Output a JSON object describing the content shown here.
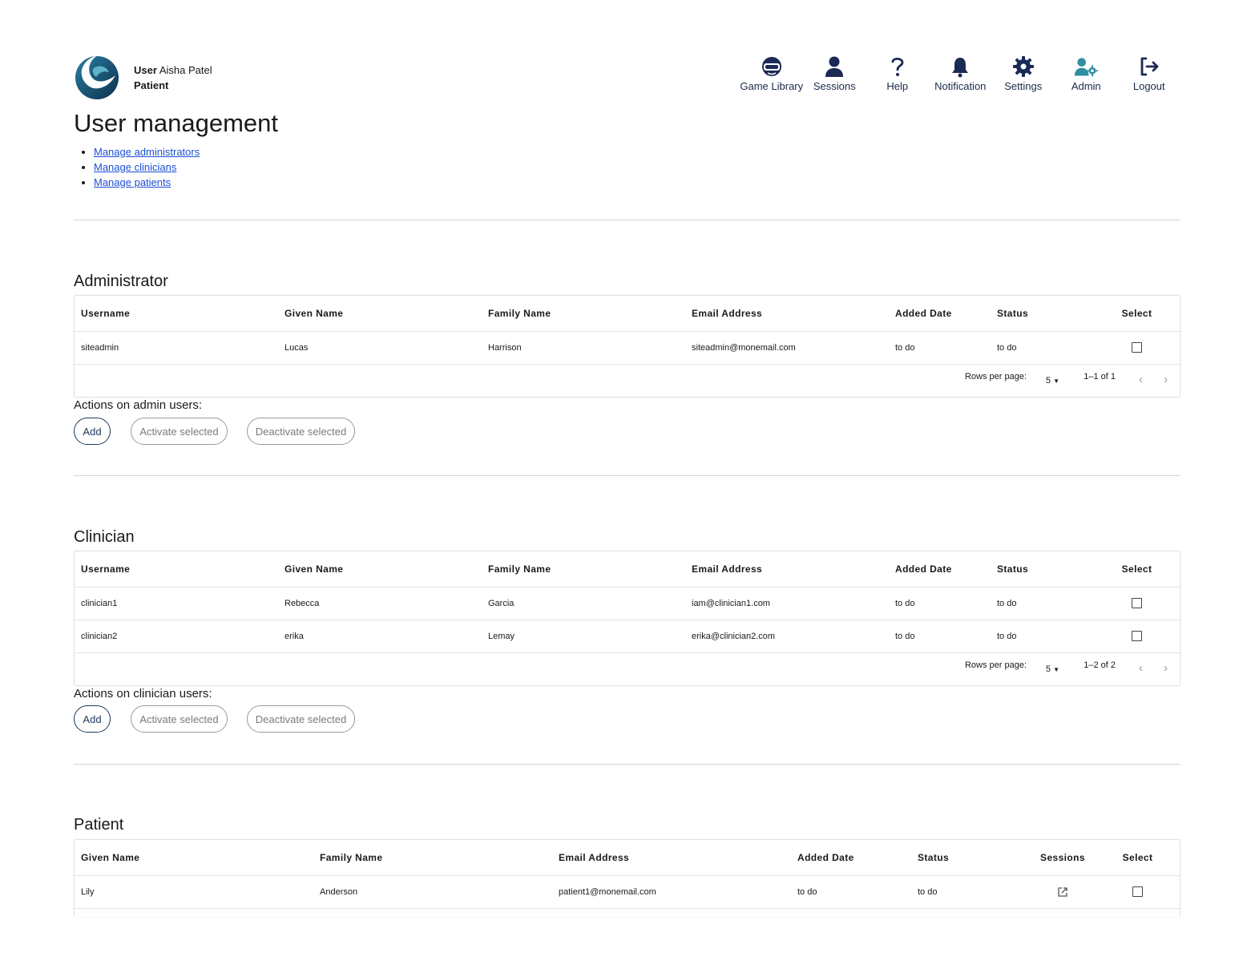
{
  "header": {
    "user_label": "User",
    "user_name": "Aisha Patel",
    "role": "Patient",
    "nav": [
      {
        "label": "Game Library",
        "icon": "vr-headset-icon"
      },
      {
        "label": "Sessions",
        "icon": "person-icon"
      },
      {
        "label": "Help",
        "icon": "question-icon"
      },
      {
        "label": "Notification",
        "icon": "bell-icon"
      },
      {
        "label": "Settings",
        "icon": "gear-icon"
      },
      {
        "label": "Admin",
        "icon": "admin-users-icon"
      },
      {
        "label": "Logout",
        "icon": "logout-icon"
      }
    ]
  },
  "page_title": "User management",
  "links": [
    "Manage administrators",
    "Manage clinicians",
    "Manage patients"
  ],
  "admin": {
    "title": "Administrator",
    "columns": [
      "Username",
      "Given Name",
      "Family Name",
      "Email Address",
      "Added Date",
      "Status",
      "Select"
    ],
    "rows": [
      [
        "siteadmin",
        "Lucas",
        "Harrison",
        "siteadmin@monemail.com",
        "to do",
        "to do"
      ]
    ],
    "rows_per_page_label": "Rows per page:",
    "rows_per_page": "5",
    "range": "1–1 of 1",
    "actions_label": "Actions on admin users:",
    "add": "Add",
    "activate": "Activate selected",
    "deactivate": "Deactivate selected"
  },
  "clinician": {
    "title": "Clinician",
    "columns": [
      "Username",
      "Given Name",
      "Family Name",
      "Email Address",
      "Added Date",
      "Status",
      "Select"
    ],
    "rows": [
      [
        "clinician1",
        "Rebecca",
        "Garcia",
        "iam@clinician1.com",
        "to do",
        "to do"
      ],
      [
        "clinician2",
        "erika",
        "Lemay",
        "erika@clinician2.com",
        "to do",
        "to do"
      ]
    ],
    "rows_per_page_label": "Rows per page:",
    "rows_per_page": "5",
    "range": "1–2 of 2",
    "actions_label": "Actions on clinician users:",
    "add": "Add",
    "activate": "Activate selected",
    "deactivate": "Deactivate selected"
  },
  "patient": {
    "title": "Patient",
    "columns": [
      "Given Name",
      "Family Name",
      "Email Address",
      "Added Date",
      "Status",
      "Sessions",
      "Select"
    ],
    "rows": [
      [
        "Lily",
        "Anderson",
        "patient1@monemail.com",
        "to do",
        "to do"
      ]
    ]
  },
  "colors": {
    "link": "#1a4fd6",
    "nav_icon": "#1b2a55",
    "admin_icon": "#2f8fa0",
    "add_border": "#1b3a5c"
  }
}
